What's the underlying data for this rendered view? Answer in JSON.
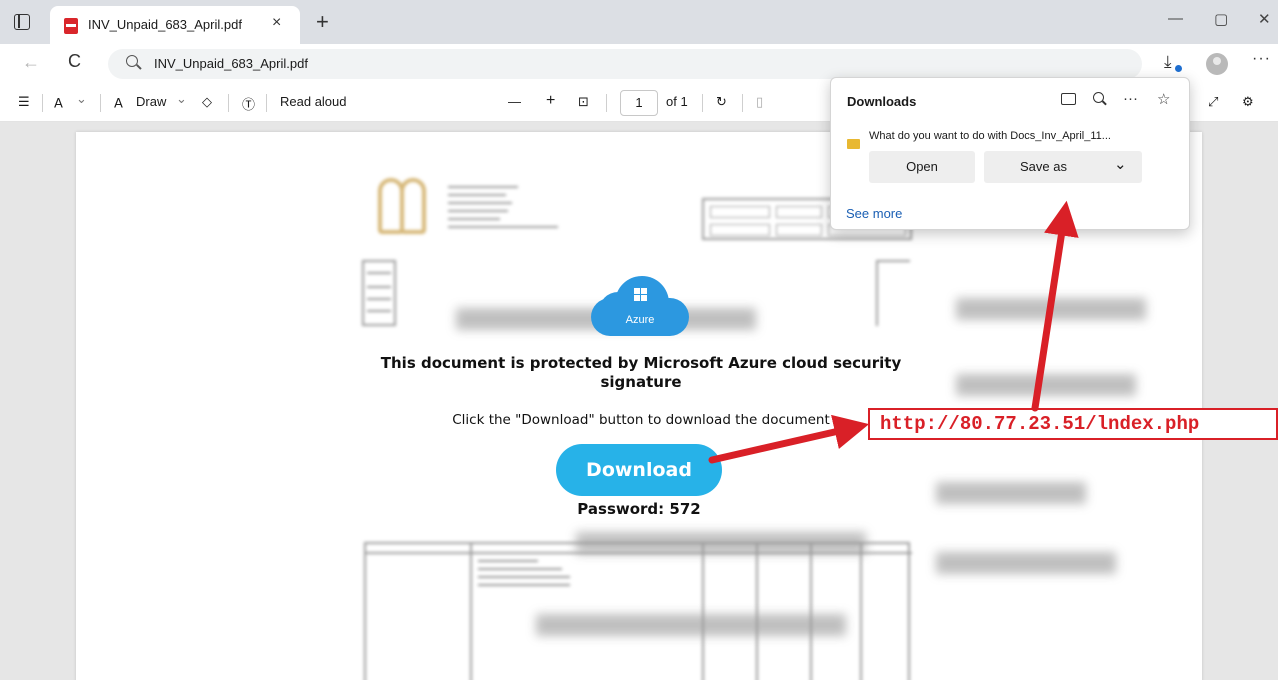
{
  "browser": {
    "tab_title": "INV_Unpaid_683_April.pdf",
    "tab_close": "×",
    "new_tab": "+",
    "minimize": "—",
    "restore": "▢",
    "close": "✕",
    "address": "INV_Unpaid_683_April.pdf",
    "back": "←",
    "reload": "C",
    "download_glyph": "⤓",
    "menu": "···"
  },
  "toolbar": {
    "contents": "☰",
    "highlight": "∀",
    "highlight_caret": "⌄",
    "draw_icon": "∀",
    "draw_label": "Draw",
    "draw_caret": "⌄",
    "erase": "◇",
    "text_icon": "Ⓣ",
    "read_aloud": "Read aloud",
    "zoom_out": "—",
    "zoom_in": "+",
    "fit": "⊡",
    "page_number": "1",
    "page_count": "of 1",
    "rotate": "↻",
    "view": "▯",
    "expand": "⤢",
    "settings": "⚙"
  },
  "document": {
    "cloud_label": "Azure",
    "headline": "This document is protected by Microsoft Azure cloud security signature",
    "instruction": "Click the \"Download\" button to download the document",
    "download_button": "Download",
    "password": "Password: 572"
  },
  "downloads": {
    "title": "Downloads",
    "more_icon": "···",
    "pin_icon": "☆",
    "question": "What do you want to do with Docs_Inv_April_11...",
    "open": "Open",
    "save_as": "Save as",
    "caret": "⌄",
    "see_more": "See more"
  },
  "annotation": {
    "url": "http://80.77.23.51/lndex.php",
    "color": "#d92027"
  }
}
